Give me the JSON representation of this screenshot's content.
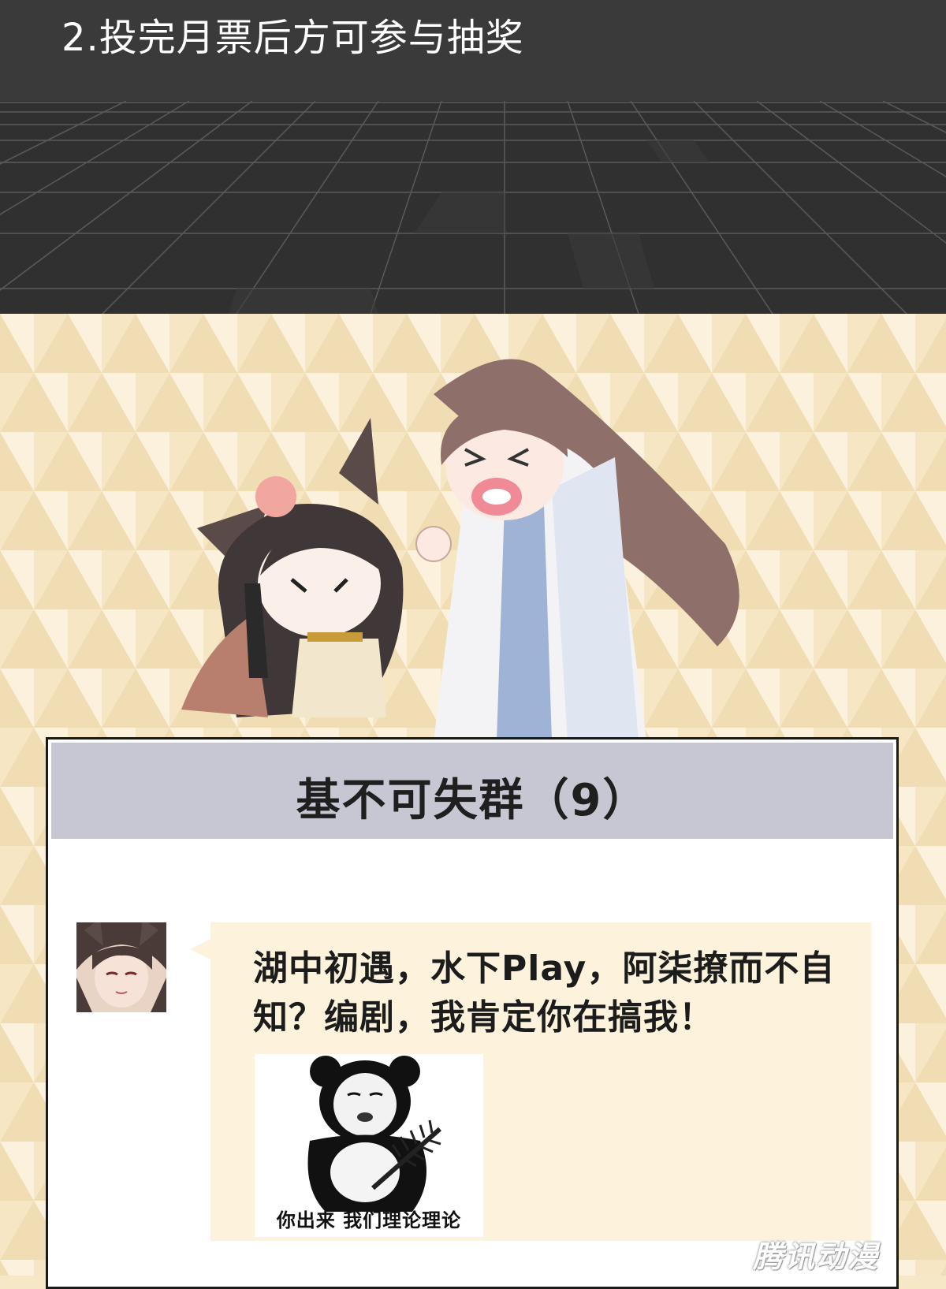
{
  "banner": {
    "text": "2.投完月票后方可参与抽奖"
  },
  "chat": {
    "title": "基不可失群（9）",
    "message": "湖中初遇，水下Play，阿柒撩而不自知？编剧，我肯定你在搞我！",
    "sticker_caption": "你出来 我们理论理论"
  },
  "watermark": "腾讯动漫",
  "colors": {
    "banner_bg": "#3a3a3a",
    "grid_bg": "#2e2e2e",
    "pattern_light": "#fbf1dc",
    "pattern_dark": "#f1ddb4",
    "chat_header_bg": "#c6c7d3",
    "bubble_bg": "#fdf3dc"
  }
}
